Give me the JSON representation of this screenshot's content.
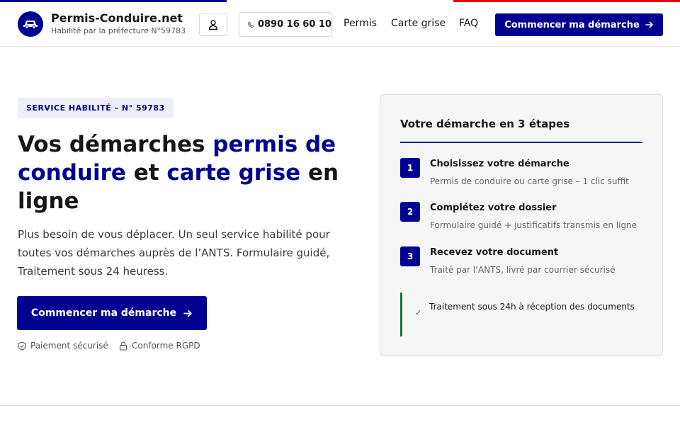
{
  "colors": {
    "primary": "#000091",
    "flag_red": "#e1000f",
    "success": "#18753c"
  },
  "header": {
    "brand_name": "Permis-Conduire.net",
    "brand_sub": "Habilité par la préfecture N°59783",
    "logo_icon": "car-icon",
    "account_icon": "user-icon",
    "phone_icon": "phone-icon",
    "phone": "0890 16 60 10",
    "nav": [
      "Permis",
      "Carte grise",
      "FAQ"
    ],
    "cta_label": "Commencer ma démarche",
    "cta_icon": "arrow-right-icon"
  },
  "hero": {
    "badge": "SERVICE HABILITÉ – N° 59783",
    "title": {
      "p1": "Vos démarches ",
      "h1": "permis de conduire",
      "p2": " et ",
      "h2": "carte grise",
      "p3": " en ligne"
    },
    "description": "Plus besoin de vous déplacer. Un seul service habilité pour toutes vos démarches auprès de l’ANTS. Formulaire guidé, Traitement sous 24 heuress.",
    "cta_label": "Commencer ma démarche",
    "trust": [
      {
        "icon": "shield-check-icon",
        "label": "Paiement sécurisé"
      },
      {
        "icon": "lock-icon",
        "label": "Conforme RGPD"
      }
    ]
  },
  "steps_card": {
    "title": "Votre démarche en 3 étapes",
    "steps": [
      {
        "num": "1",
        "title": "Choisissez votre démarche",
        "desc": "Permis de conduire ou carte grise – 1 clic suffit"
      },
      {
        "num": "2",
        "title": "Complétez votre dossier",
        "desc": "Formulaire guidé + justificatifs transmis en ligne"
      },
      {
        "num": "3",
        "title": "Recevez votre document",
        "desc": "Traité par l’ANTS, livré par courrier sécurisé"
      }
    ],
    "note_icon": "check-icon",
    "note": "Traitement sous 24h à réception des documents"
  }
}
